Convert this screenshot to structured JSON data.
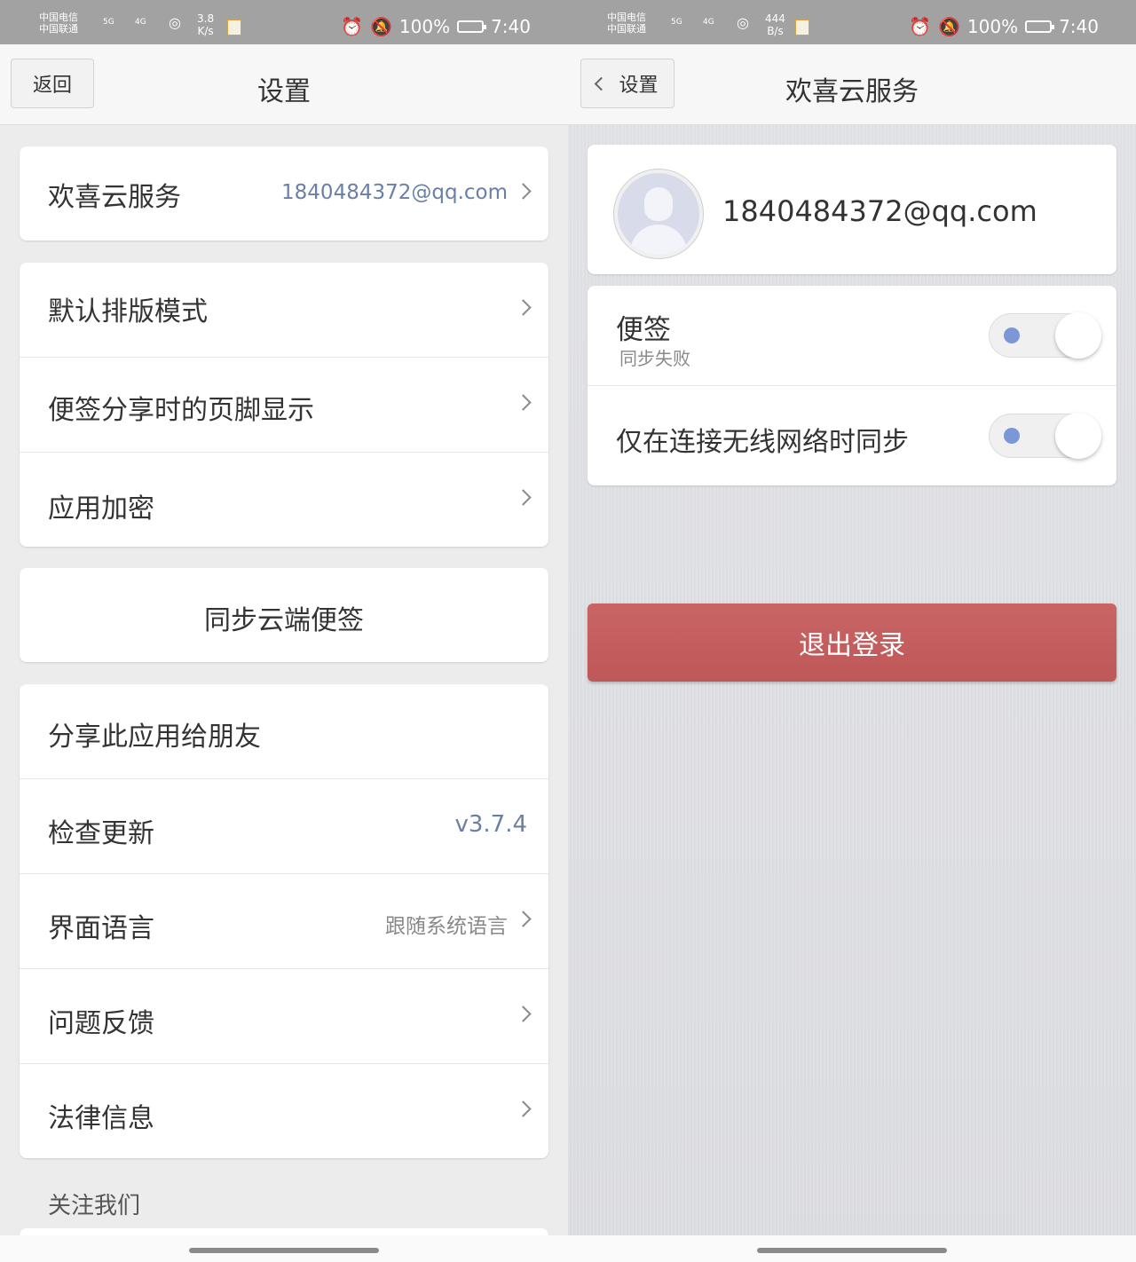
{
  "left": {
    "status": {
      "carrier1": "中国电信",
      "carrier2": "中国联通",
      "sig1": "5G",
      "sig2": "4G",
      "speed_value": "3.8",
      "speed_unit": "K/s",
      "battery": "100%",
      "time": "7:40"
    },
    "nav": {
      "back_label": "返回",
      "title": "设置"
    },
    "account": {
      "label": "欢喜云服务",
      "email": "1840484372@qq.com"
    },
    "group2": [
      {
        "label": "默认排版模式"
      },
      {
        "label": "便签分享时的页脚显示"
      },
      {
        "label": "应用加密"
      }
    ],
    "sync_button": "同步云端便签",
    "group4": {
      "share": "分享此应用给朋友",
      "update_label": "检查更新",
      "update_value": "v3.7.4",
      "language_label": "界面语言",
      "language_value": "跟随系统语言",
      "feedback": "问题反馈",
      "legal": "法律信息"
    },
    "follow_title": "关注我们"
  },
  "right": {
    "status": {
      "carrier1": "中国电信",
      "carrier2": "中国联通",
      "sig1": "5G",
      "sig2": "4G",
      "speed_value": "444",
      "speed_unit": "B/s",
      "battery": "100%",
      "time": "7:40"
    },
    "nav": {
      "back_label": "设置",
      "title": "欢喜云服务"
    },
    "account_email": "1840484372@qq.com",
    "notes_label": "便签",
    "notes_status": "同步失败",
    "wifi_label": "仅在连接无线网络时同步",
    "logout_label": "退出登录"
  },
  "colors": {
    "accent_blue": "#6a7fa8",
    "logout_red": "#c25c5c",
    "toggle_dot": "#7c97d8"
  }
}
